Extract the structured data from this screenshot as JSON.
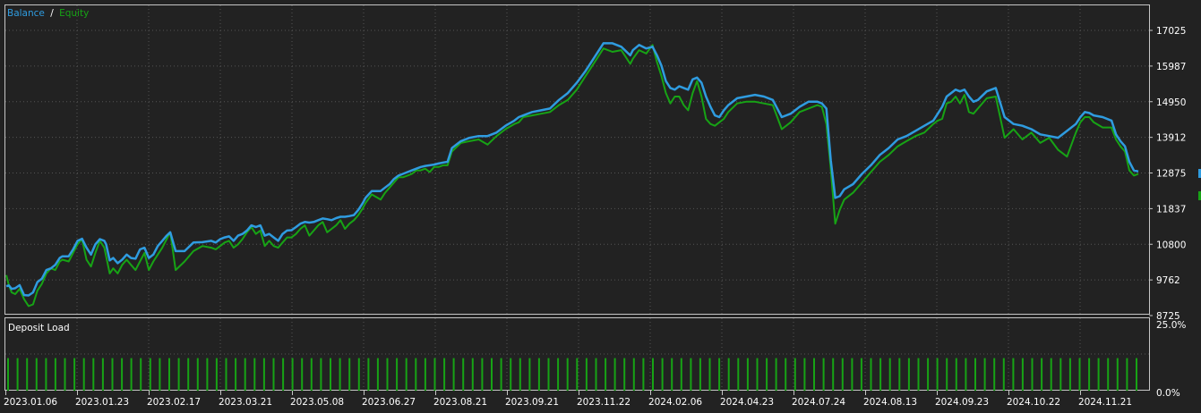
{
  "legend": {
    "balance_label": "Balance",
    "separator": "/",
    "equity_label": "Equity"
  },
  "load_panel": {
    "title": "Deposit Load",
    "max_label": "25.0%",
    "min_label": "0.0%",
    "bar_level": 0.45,
    "bar_count": 120
  },
  "colors": {
    "background": "#222222",
    "grid": "#545454",
    "frame": "#c6c6c6",
    "text": "#ffffff",
    "balance": "#2f9ce0",
    "equity": "#17a315",
    "load_bar": "#17a315"
  },
  "chart_data": {
    "type": "line",
    "title": "",
    "ylim": [
      8725,
      17300
    ],
    "yticks": [
      "17025",
      "15987",
      "14950",
      "13912",
      "12875",
      "11837",
      "10800",
      "9762",
      "8725"
    ],
    "x_tick_labels": [
      "2023.01.06",
      "2023.01.23",
      "2023.02.17",
      "2023.03.21",
      "2023.05.08",
      "2023.06.27",
      "2023.08.21",
      "2023.09.21",
      "2023.11.22",
      "2024.02.06",
      "2024.04.23",
      "2024.07.24",
      "2024.08.13",
      "2024.09.23",
      "2024.10.22",
      "2024.11.21"
    ],
    "x": [
      0,
      3,
      6,
      10,
      15,
      20,
      25,
      30,
      35,
      40,
      45,
      50,
      55,
      60,
      63,
      70,
      75,
      80,
      85,
      90,
      95,
      100,
      105,
      110,
      112,
      116,
      120,
      125,
      130,
      135,
      140,
      145,
      150,
      155,
      160,
      165,
      170,
      175,
      180,
      184,
      190,
      200,
      210,
      220,
      230,
      235,
      240,
      245,
      250,
      255,
      260,
      265,
      270,
      275,
      280,
      285,
      290,
      295,
      300,
      305,
      310,
      315,
      320,
      325,
      330,
      335,
      340,
      345,
      350,
      355,
      360,
      365,
      370,
      375,
      380,
      385,
      390,
      395,
      400,
      403,
      410,
      420,
      425,
      430,
      435,
      440,
      445,
      450,
      455,
      460,
      465,
      470,
      475,
      480,
      485,
      490,
      495,
      500,
      510,
      520,
      530,
      540,
      550,
      560,
      570,
      575,
      580,
      590,
      600,
      610,
      620,
      630,
      640,
      650,
      660,
      670,
      680,
      690,
      700,
      703,
      710,
      718,
      725,
      730,
      735,
      740,
      745,
      750,
      755,
      760,
      765,
      770,
      775,
      780,
      785,
      790,
      795,
      800,
      805,
      810,
      820,
      830,
      840,
      850,
      860,
      870,
      880,
      890,
      900,
      910,
      915,
      920,
      925,
      930,
      935,
      940,
      950,
      960,
      970,
      980,
      990,
      1000,
      1010,
      1020,
      1030,
      1040,
      1045,
      1050,
      1055,
      1060,
      1065,
      1070,
      1075,
      1080,
      1085,
      1090,
      1100,
      1110,
      1120,
      1130,
      1140,
      1150,
      1160,
      1170,
      1180,
      1190,
      1200,
      1205,
      1210,
      1215,
      1220,
      1230,
      1240,
      1245,
      1250,
      1255,
      1260,
      1265,
      1270
    ],
    "series": [
      {
        "name": "Balance",
        "values": [
          9580,
          9600,
          9500,
          9520,
          9610,
          9320,
          9310,
          9400,
          9700,
          9800,
          10050,
          10100,
          10200,
          10400,
          10450,
          10450,
          10650,
          10900,
          10960,
          10700,
          10500,
          10800,
          10950,
          10900,
          10800,
          10330,
          10400,
          10250,
          10350,
          10500,
          10400,
          10380,
          10650,
          10700,
          10400,
          10500,
          10750,
          10900,
          11050,
          11150,
          10600,
          10600,
          10850,
          10860,
          10900,
          10850,
          10950,
          11000,
          11030,
          10900,
          11050,
          11100,
          11200,
          11350,
          11300,
          11350,
          11050,
          11100,
          11000,
          10900,
          11100,
          11200,
          11210,
          11300,
          11400,
          11450,
          11430,
          11450,
          11500,
          11550,
          11530,
          11500,
          11560,
          11600,
          11600,
          11620,
          11650,
          11800,
          12000,
          12150,
          12350,
          12350,
          12450,
          12550,
          12700,
          12800,
          12850,
          12900,
          12950,
          13000,
          13050,
          13080,
          13100,
          13120,
          13150,
          13180,
          13200,
          13600,
          13800,
          13900,
          13950,
          13950,
          14050,
          14250,
          14400,
          14500,
          14550,
          14650,
          14700,
          14750,
          15000,
          15200,
          15500,
          15850,
          16250,
          16650,
          16650,
          16550,
          16300,
          16450,
          16600,
          16500,
          16550,
          16300,
          16000,
          15550,
          15350,
          15300,
          15400,
          15350,
          15300,
          15600,
          15650,
          15500,
          15100,
          14800,
          14550,
          14500,
          14700,
          14850,
          15050,
          15100,
          15150,
          15100,
          15000,
          14500,
          14600,
          14800,
          14950,
          14950,
          14900,
          14750,
          13250,
          12150,
          12200,
          12400,
          12550,
          12850,
          13100,
          13400,
          13600,
          13850,
          13950,
          14100,
          14250,
          14400,
          14600,
          14800,
          15100,
          15200,
          15300,
          15250,
          15300,
          15100,
          14950,
          15000,
          15250,
          15350,
          14500,
          14300,
          14250,
          14150,
          14000,
          13950,
          13900,
          14100,
          14300,
          14500,
          14650,
          14620,
          14550,
          14500,
          14400,
          14000,
          13800,
          13650,
          13200,
          12950,
          12920,
          12910,
          12900
        ]
      },
      {
        "name": "Equity",
        "values": [
          9900,
          9600,
          9400,
          9350,
          9500,
          9200,
          9000,
          9050,
          9450,
          9650,
          9950,
          10100,
          10050,
          10300,
          10350,
          10300,
          10550,
          10800,
          10950,
          10350,
          10150,
          10550,
          10900,
          10700,
          10450,
          9950,
          10100,
          9950,
          10200,
          10350,
          10200,
          10050,
          10300,
          10550,
          10050,
          10300,
          10500,
          10700,
          10950,
          11150,
          10050,
          10300,
          10600,
          10750,
          10700,
          10650,
          10750,
          10850,
          10900,
          10700,
          10800,
          10950,
          11150,
          11300,
          11100,
          11200,
          10750,
          10900,
          10750,
          10700,
          10850,
          11000,
          11000,
          11100,
          11250,
          11350,
          11050,
          11200,
          11350,
          11450,
          11150,
          11250,
          11350,
          11500,
          11250,
          11400,
          11500,
          11650,
          11850,
          12000,
          12250,
          12100,
          12300,
          12450,
          12600,
          12750,
          12750,
          12800,
          12850,
          12950,
          12950,
          13000,
          12900,
          13050,
          13050,
          13100,
          13100,
          13500,
          13750,
          13800,
          13850,
          13700,
          13950,
          14150,
          14300,
          14350,
          14500,
          14550,
          14600,
          14650,
          14850,
          15000,
          15300,
          15700,
          16100,
          16500,
          16400,
          16450,
          16050,
          16200,
          16450,
          16350,
          16600,
          16100,
          15700,
          15200,
          14900,
          15100,
          15100,
          14850,
          14700,
          15200,
          15550,
          15100,
          14450,
          14300,
          14250,
          14350,
          14450,
          14650,
          14900,
          14950,
          14950,
          14900,
          14850,
          14150,
          14350,
          14650,
          14750,
          14850,
          14800,
          14300,
          13000,
          11400,
          11800,
          12100,
          12300,
          12600,
          12900,
          13200,
          13400,
          13650,
          13800,
          13950,
          14050,
          14300,
          14400,
          14450,
          14900,
          14950,
          15100,
          14900,
          15150,
          14650,
          14600,
          14750,
          15050,
          15100,
          13900,
          14150,
          13850,
          14050,
          13750,
          13900,
          13550,
          13350,
          14050,
          14350,
          14500,
          14500,
          14350,
          14200,
          14200,
          13850,
          13650,
          13500,
          12950,
          12800,
          12850,
          12700,
          12850
        ]
      }
    ]
  }
}
